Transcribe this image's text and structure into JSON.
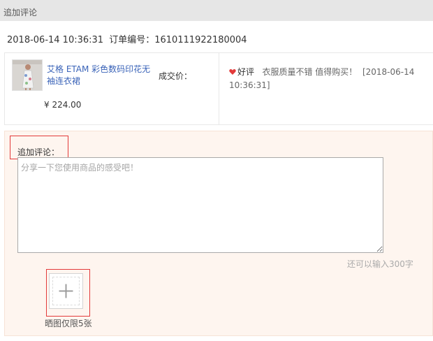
{
  "header": {
    "title": "追加评论"
  },
  "order": {
    "datetime": "2018-06-14 10:36:31",
    "number_label": "订单编号：",
    "number": "1610111922180004"
  },
  "product": {
    "name": "艾格 ETAM 彩色数码印花无袖连衣裙",
    "price": "¥ 224.00",
    "deal_price_label": "成交价：",
    "thumbnail_icon": "product-photo-dress"
  },
  "review": {
    "rating_icon": "heart-icon",
    "rating_color": "#e33a3a",
    "rating": "好评",
    "text": "衣服质量不错 值得购买！",
    "timestamp": "[2018-06-14 10:36:31]"
  },
  "append": {
    "label": "追加评论：",
    "placeholder": "分享一下您使用商品的感受吧！",
    "value": "",
    "remaining": "还可以输入300字",
    "upload_icon": "plus-icon",
    "upload_hint": "晒图仅限5张"
  },
  "colors": {
    "link": "#3a63b8",
    "highlight_border": "#e33a3a",
    "panel_bg": "#fef5ef",
    "header_bg": "#e6e6e6"
  }
}
